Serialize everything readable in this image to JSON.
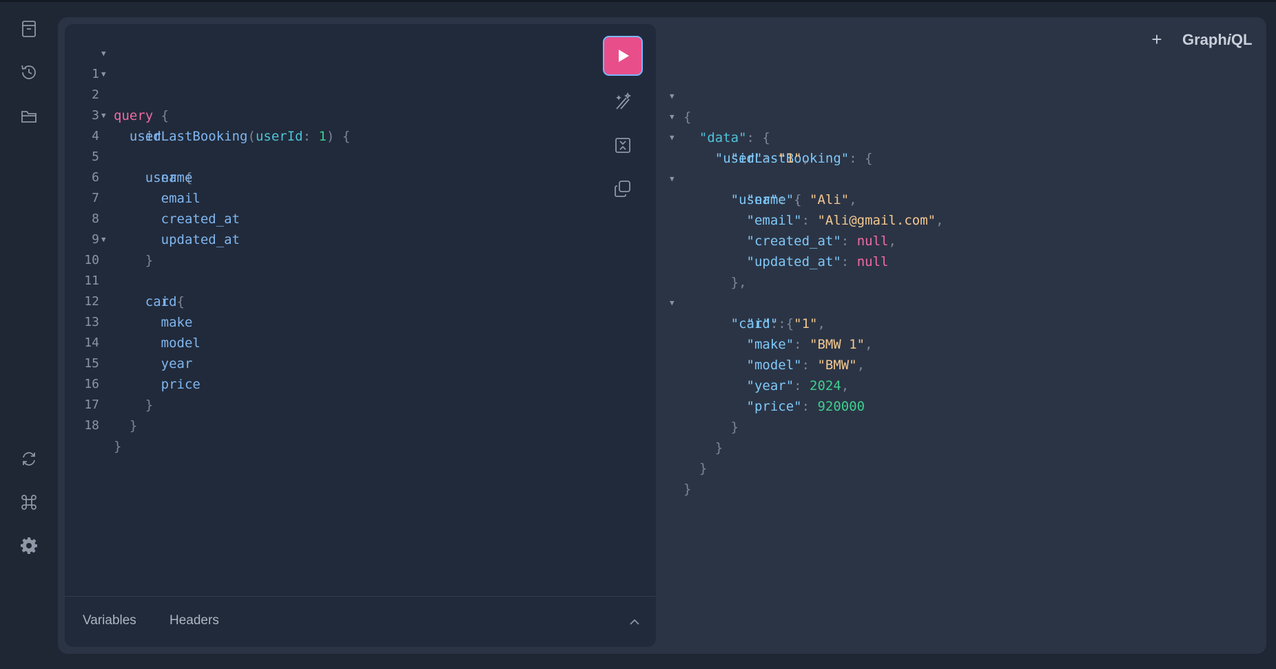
{
  "header": {
    "brand_prefix": "Graph",
    "brand_italic": "i",
    "brand_suffix": "QL",
    "add_tab": "+"
  },
  "sidebar": {
    "items": [
      {
        "icon": "docs-icon"
      },
      {
        "icon": "history-icon"
      },
      {
        "icon": "explorer-folder-icon"
      },
      {
        "icon": "refetch-schema-icon"
      },
      {
        "icon": "shortcuts-command-icon"
      },
      {
        "icon": "settings-gear-icon"
      }
    ]
  },
  "editor": {
    "lines": [
      {
        "n": "1",
        "fold": true
      },
      {
        "n": "2",
        "fold": true
      },
      {
        "n": "3",
        "fold": false
      },
      {
        "n": "4",
        "fold": true
      },
      {
        "n": "5",
        "fold": false
      },
      {
        "n": "6",
        "fold": false
      },
      {
        "n": "7",
        "fold": false
      },
      {
        "n": "8",
        "fold": false
      },
      {
        "n": "9",
        "fold": false
      },
      {
        "n": "10",
        "fold": true
      },
      {
        "n": "11",
        "fold": false
      },
      {
        "n": "12",
        "fold": false
      },
      {
        "n": "13",
        "fold": false
      },
      {
        "n": "14",
        "fold": false
      },
      {
        "n": "15",
        "fold": false
      },
      {
        "n": "16",
        "fold": false
      },
      {
        "n": "17",
        "fold": false
      },
      {
        "n": "18",
        "fold": false
      }
    ],
    "tokens": {
      "query": "query",
      "brace_open": "{",
      "brace_close": "}",
      "op_name": "userLastBooking",
      "paren_open": "(",
      "arg_name": "userId",
      "colon": ":",
      "arg_value": "1",
      "paren_close": ")",
      "id": "id",
      "user": "user",
      "name": "name",
      "email": "email",
      "created_at": "created_at",
      "updated_at": "updated_at",
      "car": "car",
      "make": "make",
      "model": "model",
      "year": "year",
      "price": "price"
    }
  },
  "bottom_tabs": {
    "variables": "Variables",
    "headers": "Headers"
  },
  "result": {
    "k_data": "\"data\"",
    "k_userLastBooking": "\"userLastBooking\"",
    "k_id": "\"id\"",
    "v_id": "\"1\"",
    "k_user": "\"user\"",
    "k_name": "\"name\"",
    "v_name": "\"Ali\"",
    "k_email": "\"email\"",
    "v_email": "\"Ali@gmail.com\"",
    "k_created_at": "\"created_at\"",
    "k_updated_at": "\"updated_at\"",
    "v_null": "null",
    "k_car": "\"car\"",
    "k_car_id": "\"id\"",
    "v_car_id": "\"1\"",
    "k_make": "\"make\"",
    "v_make": "\"BMW 1\"",
    "k_model": "\"model\"",
    "v_model": "\"BMW\"",
    "k_year": "\"year\"",
    "v_year": "2024",
    "k_price": "\"price\"",
    "v_price": "920000",
    "p_open": "{",
    "p_close": "}",
    "p_close_comma": "},",
    "p_colon_sp": ": ",
    "p_comma": ","
  },
  "colors": {
    "accent_run": "#e84f8a",
    "keyword": "#f06ba3",
    "field": "#7fb6f0",
    "string": "#f2c78f",
    "number": "#3ecf8e"
  }
}
